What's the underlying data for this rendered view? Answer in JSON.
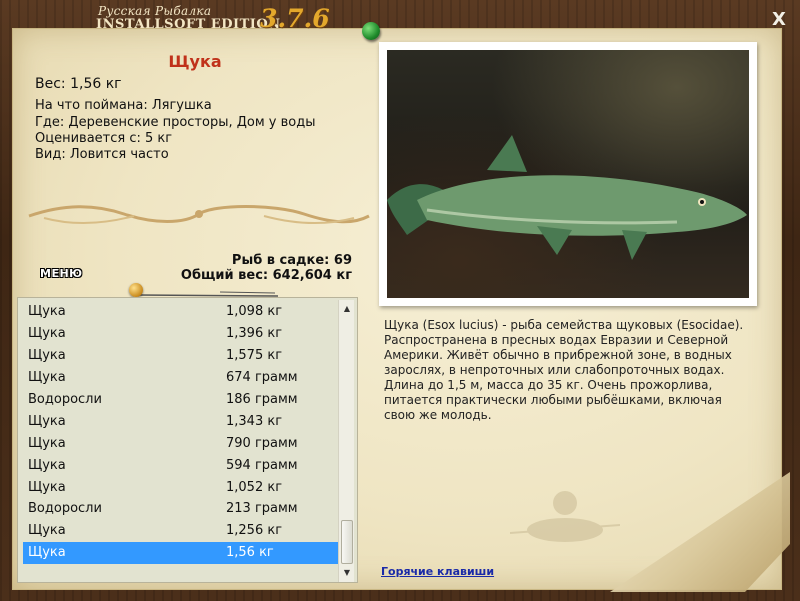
{
  "app": {
    "title_ru": "Русская Рыбалка",
    "edition": "INSTALLSOFT EDITION",
    "version": "3.7.6",
    "close_label": "X"
  },
  "catch": {
    "name": "Щука",
    "weight_line": "Вес: 1,56 кг",
    "bait_line": "На что поймана: Лягушка",
    "where_line": "Где: Деревенские просторы, Дом у воды",
    "rated_line": "Оценивается с: 5 кг",
    "kind_line": "Вид: Ловится часто"
  },
  "cage": {
    "fish_count": "Рыб в садке: 69",
    "total_weight": "Общий вес: 642,604 кг"
  },
  "menu_label": "МЕНЮ",
  "catch_list": [
    {
      "name": "Щука",
      "weight": "1,098 кг"
    },
    {
      "name": "Щука",
      "weight": "1,396 кг"
    },
    {
      "name": "Щука",
      "weight": "1,575 кг"
    },
    {
      "name": "Щука",
      "weight": "674 грамм"
    },
    {
      "name": "Водоросли",
      "weight": "186 грамм"
    },
    {
      "name": "Щука",
      "weight": "1,343 кг"
    },
    {
      "name": "Щука",
      "weight": "790 грамм"
    },
    {
      "name": "Щука",
      "weight": "594 грамм"
    },
    {
      "name": "Щука",
      "weight": "1,052 кг"
    },
    {
      "name": "Водоросли",
      "weight": "213 грамм"
    },
    {
      "name": "Щука",
      "weight": "1,256 кг"
    },
    {
      "name": "Щука",
      "weight": "1,56 кг",
      "selected": true
    }
  ],
  "description": "Щука (Esox lucius) - рыба семейства щуковых (Esocidae). Распространена в пресных водах Евразии и Северной Америки. Живёт обычно в прибрежной зоне, в водных зарослях, в непроточных или слабопроточных водах. Длина до 1,5 м, масса до 35 кг. Очень прожорлива, питается практически любыми рыбёшками, включая свою же молодь.",
  "hotkeys_link": "Горячие клавиши",
  "colors": {
    "fish_name": "#c0311a",
    "selection": "#3399ff",
    "link": "#1a2aa8",
    "version": "#e3a82c"
  }
}
